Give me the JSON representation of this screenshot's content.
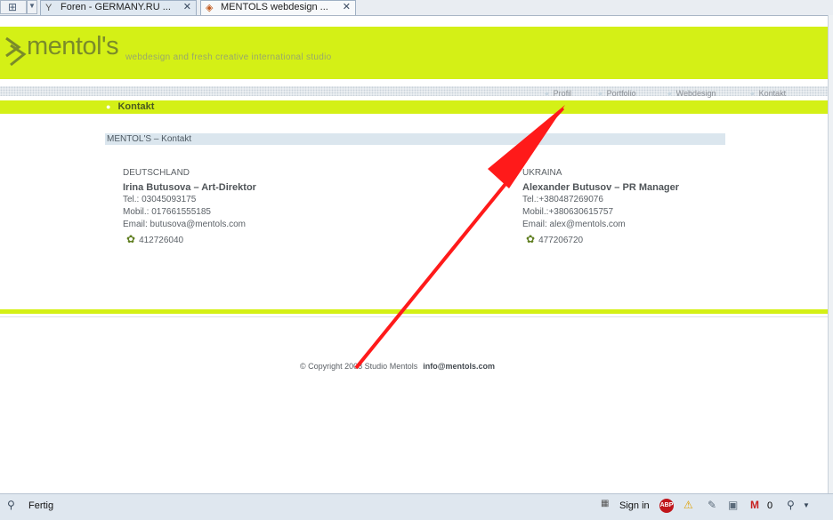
{
  "browser": {
    "tabs": [
      {
        "label": "Foren - GERMANY.RU ...",
        "icon": "filter-icon"
      },
      {
        "label": "MENTOLS webdesign ...",
        "icon": "page-icon"
      }
    ],
    "status": "Fertig",
    "status_signin": "Sign in",
    "mail_count": "0"
  },
  "site": {
    "logo_text": "mentol's",
    "tagline": "webdesign and fresh creative international studio",
    "nav": [
      "Profil",
      "Portfolio",
      "Webdesign",
      "Kontakt"
    ],
    "active_nav": "Kontakt",
    "breadcrumb": "MENTOL'S – Kontakt"
  },
  "contacts": [
    {
      "country": "DEUTSCHLAND",
      "name": "Irina Butusova – Art-Direktor",
      "tel": "Tel.: 03045093175",
      "mobil": "Mobil.: 017661555185",
      "email": "Email: butusova@mentols.com",
      "icq": "412726040"
    },
    {
      "country": "UKRAINA",
      "name": "Alexander Butusov – PR Manager",
      "tel": "Tel.:+380487269076",
      "mobil": "Mobil.:+380630615757",
      "email": "Email: alex@mentols.com",
      "icq": "477206720"
    }
  ],
  "footer": {
    "copyright": "© Copyright 2008 Studio Mentols",
    "email": "info@mentols.com"
  },
  "colors": {
    "accent_green": "#d4f016",
    "annotation_red": "#ff1a1a"
  }
}
